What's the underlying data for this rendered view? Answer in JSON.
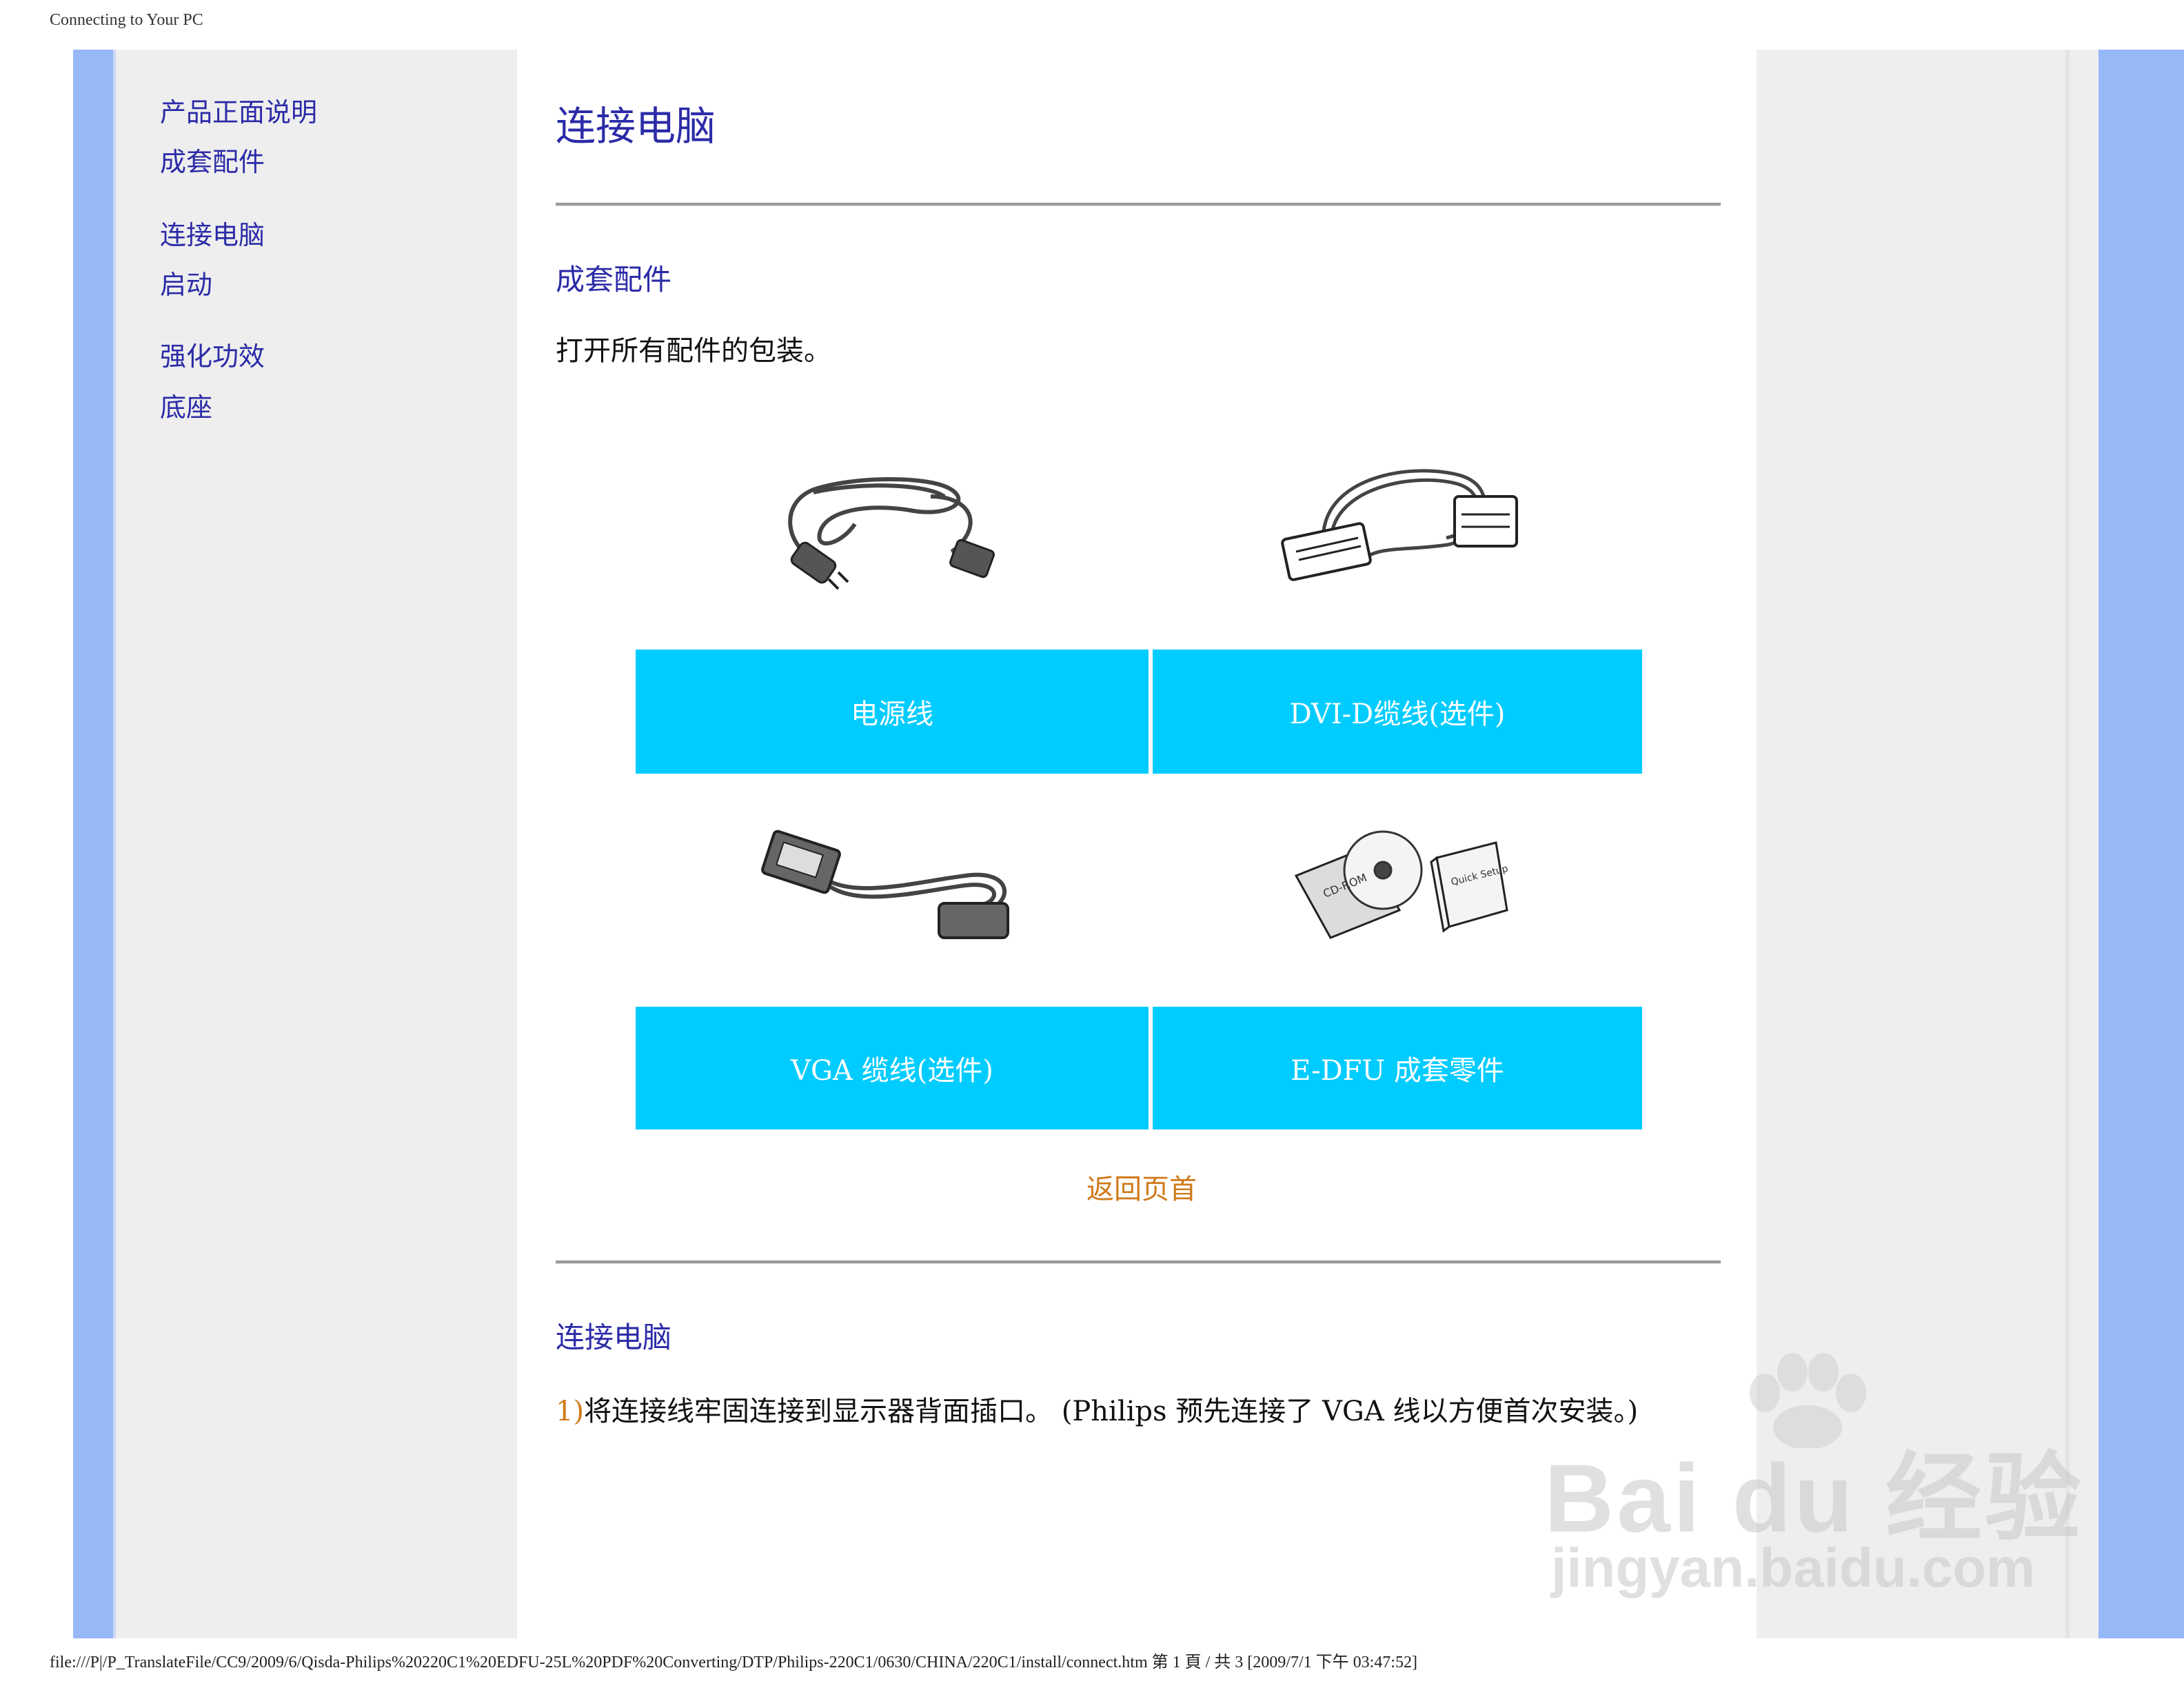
{
  "header": {
    "title": "Connecting to Your PC"
  },
  "nav": {
    "items": [
      {
        "label": "产品正面说明"
      },
      {
        "label": "成套配件"
      },
      {
        "label": "连接电脑"
      },
      {
        "label": "启动"
      },
      {
        "label": "强化功效"
      },
      {
        "label": "底座"
      }
    ]
  },
  "main": {
    "title": "连接电脑",
    "accessories": {
      "heading": "成套配件",
      "intro": "打开所有配件的包装。",
      "items": [
        {
          "label": "电源线",
          "icon": "power-cord-illustration"
        },
        {
          "label": "DVI-D缆线(选件)",
          "icon": "dvi-cable-illustration"
        },
        {
          "label": "VGA 缆线(选件)",
          "icon": "vga-cable-illustration"
        },
        {
          "label": "E-DFU 成套零件",
          "icon": "cd-rom-and-quick-setup-guide-illustration"
        }
      ],
      "label_bg_color": "#00ccff"
    },
    "back_to_top": "返回页首",
    "connect": {
      "heading": "连接电脑",
      "step1_num": "1)",
      "step1_text": "将连接线牢固连接到显示器背面插口。 (Philips 预先连接了 VGA 线以方便首次安装。)"
    }
  },
  "illustration_text": {
    "cd": "CD-ROM",
    "guide": "Quick Setup Guide"
  },
  "footer": {
    "path": "file:///P|/P_TranslateFile/CC9/2009/6/Qisda-Philips%20220C1%20EDFU-25L%20PDF%20Converting/DTP/Philips-220C1/0630/CHINA/220C1/install/connect.htm 第 1 頁 / 共 3  [2009/7/1 下午 03:47:52]"
  },
  "watermark": {
    "brand": "Bai du 经验",
    "domain": "jingyan.baidu.com"
  },
  "colors": {
    "link": "#2b2ba8",
    "accent": "#d07a1a",
    "side_strip": "#97b8f7"
  }
}
